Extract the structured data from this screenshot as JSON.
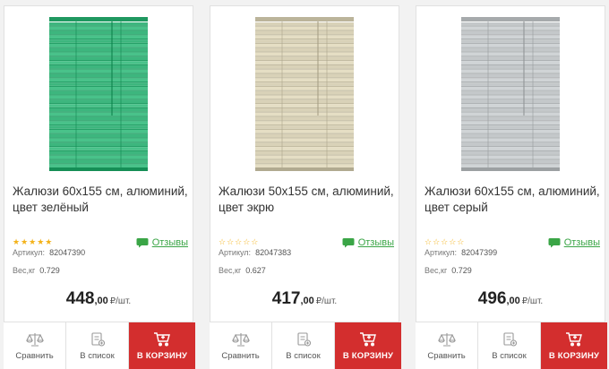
{
  "products": [
    {
      "title": "Жалюзи 60х155 см, алюминий, цвет зелёный",
      "stars": "★★★★★",
      "stars_filled": true,
      "reviews_label": "Отзывы",
      "article_label": "Артикул:",
      "article": "82047390",
      "weight_label": "Вес,кг",
      "weight": "0.729",
      "price_main": "448",
      "price_cents": ",00",
      "price_unit": "₽/шт.",
      "compare_label": "Сравнить",
      "list_label": "В список",
      "cart_label": "В КОРЗИНУ",
      "color": "#3db67e"
    },
    {
      "title": "Жалюзи 50х155 см, алюминий, цвет экрю",
      "stars": "☆☆☆☆☆",
      "stars_filled": false,
      "reviews_label": "Отзывы",
      "article_label": "Артикул:",
      "article": "82047383",
      "weight_label": "Вес,кг",
      "weight": "0.627",
      "price_main": "417",
      "price_cents": ",00",
      "price_unit": "₽/шт.",
      "compare_label": "Сравнить",
      "list_label": "В список",
      "cart_label": "В КОРЗИНУ",
      "color": "#d9d2b8"
    },
    {
      "title": "Жалюзи 60х155 см, алюминий, цвет серый",
      "stars": "☆☆☆☆☆",
      "stars_filled": false,
      "reviews_label": "Отзывы",
      "article_label": "Артикул:",
      "article": "82047399",
      "weight_label": "Вес,кг",
      "weight": "0.729",
      "price_main": "496",
      "price_cents": ",00",
      "price_unit": "₽/шт.",
      "compare_label": "Сравнить",
      "list_label": "В список",
      "cart_label": "В КОРЗИНУ",
      "color": "#c4c8ca"
    }
  ],
  "colors": {
    "accent_green": "#3aa546",
    "cart_red": "#d32e2e",
    "star_yellow": "#f3b21a"
  }
}
